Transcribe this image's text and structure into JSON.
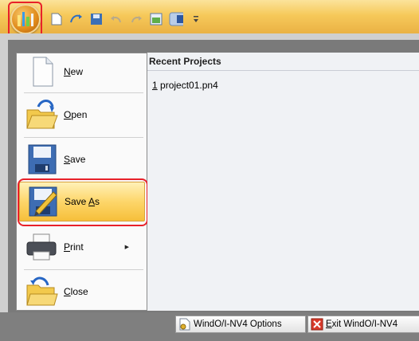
{
  "app": {
    "quick_access": [
      "new-icon",
      "open-icon",
      "save-icon",
      "undo-icon",
      "redo-icon",
      "view-icon",
      "layout-icon",
      "customize-icon"
    ]
  },
  "menu": {
    "items": [
      {
        "label_pre": "",
        "accel": "N",
        "label_post": "ew",
        "icon": "new-document-icon"
      },
      {
        "label_pre": "",
        "accel": "O",
        "label_post": "pen",
        "icon": "open-folder-icon"
      },
      {
        "label_pre": "",
        "accel": "S",
        "label_post": "ave",
        "icon": "floppy-disk-icon"
      },
      {
        "label_pre": "Save ",
        "accel": "A",
        "label_post": "s",
        "icon": "save-as-icon"
      },
      {
        "label_pre": "",
        "accel": "P",
        "label_post": "rint",
        "icon": "printer-icon"
      },
      {
        "label_pre": "",
        "accel": "C",
        "label_post": "lose",
        "icon": "close-folder-icon"
      }
    ],
    "active_index": 3
  },
  "recent": {
    "title": "Recent Projects",
    "items": [
      {
        "num": "1",
        "name": " project01.pn4"
      }
    ]
  },
  "footer": {
    "options_label": "WindO/I-NV4 Options",
    "exit_pre": "",
    "exit_accel": "E",
    "exit_post": "xit WindO/I-NV4"
  },
  "colors": {
    "highlight": "#e8212a",
    "active_item": "#fdd66a",
    "title_bar": "#f6c95a"
  }
}
